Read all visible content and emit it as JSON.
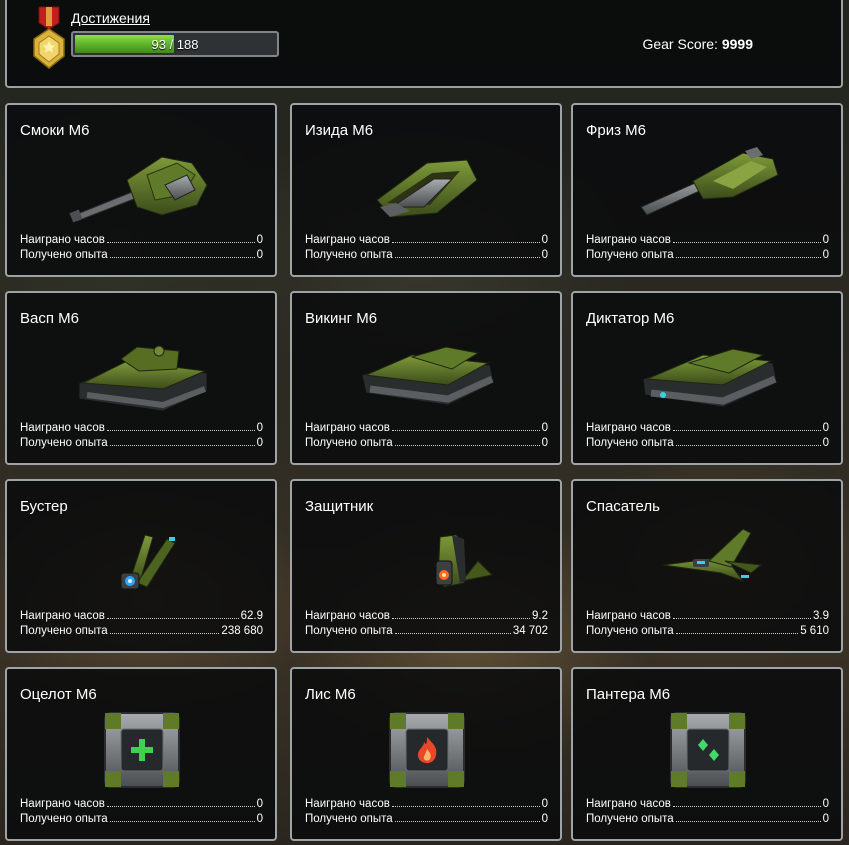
{
  "header": {
    "achievements_label": "Достижения",
    "progress": {
      "current": 93,
      "total": 188,
      "text_current": "93",
      "text_total": "188",
      "separator": " / "
    },
    "gear_score_label": "Gear Score:",
    "gear_score_value": "9999"
  },
  "stats_labels": {
    "hours": "Наиграно часов",
    "exp": "Получено опыта"
  },
  "cards": [
    {
      "title": "Смоки М6",
      "hours": "0",
      "exp": "0",
      "icon": "smoky-turret-icon"
    },
    {
      "title": "Изида М6",
      "hours": "0",
      "exp": "0",
      "icon": "isida-turret-icon"
    },
    {
      "title": "Фриз М6",
      "hours": "0",
      "exp": "0",
      "icon": "freeze-turret-icon"
    },
    {
      "title": "Васп М6",
      "hours": "0",
      "exp": "0",
      "icon": "wasp-hull-icon"
    },
    {
      "title": "Викинг М6",
      "hours": "0",
      "exp": "0",
      "icon": "viking-hull-icon"
    },
    {
      "title": "Диктатор М6",
      "hours": "0",
      "exp": "0",
      "icon": "dictator-hull-icon"
    },
    {
      "title": "Бустер",
      "hours": "62.9",
      "exp": "238 680",
      "icon": "booster-drone-icon"
    },
    {
      "title": "Защитник",
      "hours": "9.2",
      "exp": "34 702",
      "icon": "defender-drone-icon"
    },
    {
      "title": "Спасатель",
      "hours": "3.9",
      "exp": "5 610",
      "icon": "saviour-drone-icon"
    },
    {
      "title": "Оцелот М6",
      "hours": "0",
      "exp": "0",
      "icon": "ocelot-module-icon"
    },
    {
      "title": "Лис М6",
      "hours": "0",
      "exp": "0",
      "icon": "fox-module-icon"
    },
    {
      "title": "Пантера М6",
      "hours": "0",
      "exp": "0",
      "icon": "panther-module-icon"
    }
  ],
  "colors": {
    "accent_green": "#5fb42b",
    "border": "#9ea3a6",
    "module_plus": "#3fd14a",
    "module_fire": "#e8472a",
    "module_diamond": "#43d96a"
  }
}
